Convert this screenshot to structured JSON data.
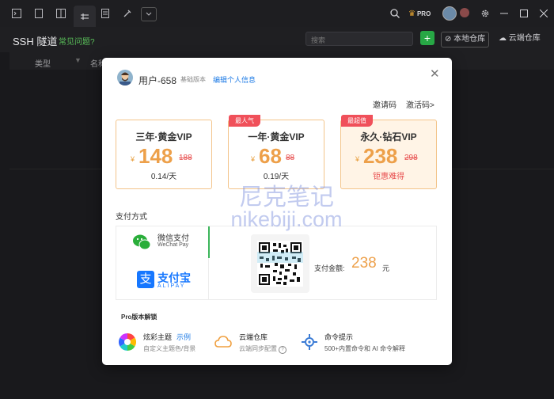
{
  "app": {
    "title": "SSH 隧道",
    "faq": "常见问题?"
  },
  "titlebar": {
    "icons": [
      "terminal-icon",
      "file-icon",
      "layout-icon",
      "tunnel-icon",
      "list-icon",
      "tools-icon",
      "chevron-down-icon"
    ],
    "pro_badge": "PRO"
  },
  "toolbar": {
    "search_placeholder": "搜索",
    "add_label": "+",
    "local_repo": "本地仓库",
    "cloud_repo": "云端仓库"
  },
  "table": {
    "columns": [
      "类型",
      "名称"
    ]
  },
  "modal": {
    "username": "用户-658",
    "edition": "基础版本",
    "edit_profile": "编辑个人信息",
    "invite_code": "邀请码",
    "activation_code": "激活码>",
    "plans": [
      {
        "name": "三年·黄金VIP",
        "currency": "¥",
        "price": "148",
        "original": "188",
        "per": "0.14/天",
        "badge": ""
      },
      {
        "name": "一年·黄金VIP",
        "currency": "¥",
        "price": "68",
        "original": "88",
        "per": "0.19/天",
        "badge": "最人气"
      },
      {
        "name": "永久·钻石VIP",
        "currency": "¥",
        "price": "238",
        "original": "298",
        "per": "钜惠难得",
        "badge": "最超值"
      }
    ],
    "payment": {
      "title": "支付方式",
      "wechat_cn": "微信支付",
      "wechat_en": "WeChat Pay",
      "alipay_cn": "支付宝",
      "alipay_en": "ALIPAY",
      "amount_label": "支付金额:",
      "amount": "238",
      "amount_unit": "元"
    },
    "unlock": {
      "title": "Pro版本解锁",
      "features": [
        {
          "title": "炫彩主题",
          "extra": "示例",
          "desc": "自定义主题色/背景"
        },
        {
          "title": "云端仓库",
          "extra": "",
          "desc": "云端同步配置"
        },
        {
          "title": "命令提示",
          "extra": "",
          "desc": "500+内置命令和 AI 命令解释"
        }
      ]
    }
  },
  "watermark": {
    "line1": "尼克笔记",
    "line2": "nikebiji.com"
  }
}
